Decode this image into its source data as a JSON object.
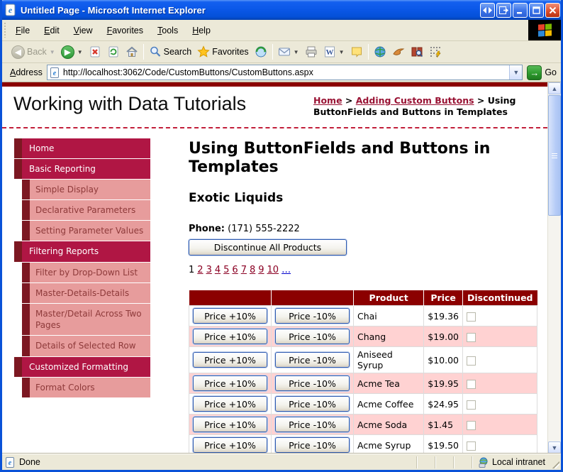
{
  "window": {
    "title": "Untitled Page - Microsoft Internet Explorer",
    "status_left": "Done",
    "status_right": "Local intranet"
  },
  "menu": {
    "items": [
      "File",
      "Edit",
      "View",
      "Favorites",
      "Tools",
      "Help"
    ]
  },
  "toolbar": {
    "back_label": "Back",
    "search_label": "Search",
    "favorites_label": "Favorites"
  },
  "address": {
    "label": "Address",
    "url": "http://localhost:3062/Code/CustomButtons/CustomButtons.aspx",
    "go_label": "Go"
  },
  "icons": {
    "back_arrow": "◀",
    "forward_arrow": "▶",
    "dropdown_caret": "▼",
    "go_arrow": "→",
    "minimize": "_",
    "close": "×",
    "scroll_up": "▲",
    "scroll_down": "▼"
  },
  "page": {
    "site_title": "Working with Data Tutorials",
    "breadcrumb": {
      "home": "Home",
      "sep1": " > ",
      "section": "Adding Custom Buttons",
      "sep2": " > ",
      "current": "Using ButtonFields and Buttons in Templates"
    },
    "heading": "Using ButtonFields and Buttons in Templates",
    "supplier": "Exotic Liquids",
    "phone_label": "Phone:",
    "phone_value": " (171) 555-2222",
    "discontinue_button": "Discontinue All Products",
    "pager": {
      "current": "1",
      "pages": [
        "2",
        "3",
        "4",
        "5",
        "6",
        "7",
        "8",
        "9",
        "10"
      ],
      "more": "…"
    }
  },
  "sidebar": {
    "items": [
      {
        "label": "Home",
        "level": 1
      },
      {
        "label": "Basic Reporting",
        "level": 1
      },
      {
        "label": "Simple Display",
        "level": 2
      },
      {
        "label": "Declarative Parameters",
        "level": 2
      },
      {
        "label": "Setting Parameter Values",
        "level": 2
      },
      {
        "label": "Filtering Reports",
        "level": 1
      },
      {
        "label": "Filter by Drop-Down List",
        "level": 2
      },
      {
        "label": "Master-Details-Details",
        "level": 2
      },
      {
        "label": "Master/Detail Across Two Pages",
        "level": 2
      },
      {
        "label": "Details of Selected Row",
        "level": 2
      },
      {
        "label": "Customized Formatting",
        "level": 1
      },
      {
        "label": "Format Colors",
        "level": 2
      }
    ]
  },
  "table": {
    "headers": [
      "",
      "",
      "Product",
      "Price",
      "Discontinued"
    ],
    "button_plus": "Price +10%",
    "button_minus": "Price -10%",
    "rows": [
      {
        "product": "Chai",
        "price": "$19.36",
        "discontinued": false
      },
      {
        "product": "Chang",
        "price": "$19.00",
        "discontinued": false
      },
      {
        "product": "Aniseed Syrup",
        "price": "$10.00",
        "discontinued": false
      },
      {
        "product": "Acme Tea",
        "price": "$19.95",
        "discontinued": false
      },
      {
        "product": "Acme Coffee",
        "price": "$24.95",
        "discontinued": false
      },
      {
        "product": "Acme Soda",
        "price": "$1.45",
        "discontinued": false
      },
      {
        "product": "Acme Syrup",
        "price": "$19.50",
        "discontinued": false
      }
    ]
  },
  "colors": {
    "title_bar": "#0b58e8",
    "chrome": "#ECE9D8",
    "page_accent_dark": "#8B0000",
    "sidebar_level1": "#b01644",
    "sidebar_level2": "#e79c9c",
    "sidebar_square": "#7c1822",
    "row_alt_pink": "#ffd2d2",
    "link_maroon": "#991233",
    "link_blue": "#0000cc"
  }
}
